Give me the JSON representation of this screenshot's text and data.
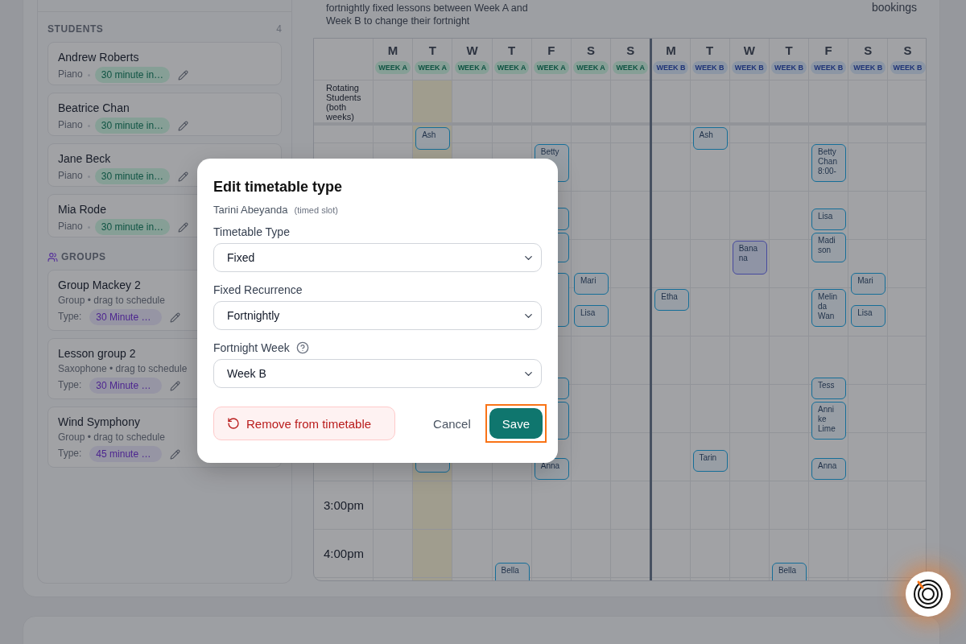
{
  "header": {
    "description": "fortnightly fixed lessons between Week A and Week B to change their fortnight",
    "bookings_label": "bookings"
  },
  "sidebar": {
    "students_title": "STUDENTS",
    "students_count": "4",
    "students": [
      {
        "name": "Andrew Roberts",
        "instrument": "Piano",
        "lesson_type": "30 minute in…"
      },
      {
        "name": "Beatrice Chan",
        "instrument": "Piano",
        "lesson_type": "30 minute in…"
      },
      {
        "name": "Jane Beck",
        "instrument": "Piano",
        "lesson_type": "30 minute in…"
      },
      {
        "name": "Mia Rode",
        "instrument": "Piano",
        "lesson_type": "30 minute in…"
      }
    ],
    "groups_title": "GROUPS",
    "groups": [
      {
        "name": "Group Mackey 2",
        "subtitle": "Group • drag to schedule",
        "type_label": "Type:",
        "lesson_type": "30 Minute …"
      },
      {
        "name": "Lesson group 2",
        "subtitle": "Saxophone • drag to schedule",
        "type_label": "Type:",
        "lesson_type": "30 Minute …"
      },
      {
        "name": "Wind Symphony",
        "subtitle": "Group • drag to schedule",
        "type_label": "Type:",
        "lesson_type": "45 minute …"
      }
    ]
  },
  "timetable": {
    "rotating_label": "Rotating Students (both weeks)",
    "time_labels": [
      {
        "label": "3:00pm"
      },
      {
        "label": "4:00pm"
      }
    ],
    "weeks": [
      {
        "kind": "a",
        "days": [
          {
            "letter": "M",
            "week": "WEEK A",
            "highlighted": false
          },
          {
            "letter": "T",
            "week": "WEEK A",
            "highlighted": true,
            "events": [
              {
                "kind": "student",
                "lines": [
                  "Ash"
                ]
              },
              {
                "kind": "student"
              }
            ]
          },
          {
            "letter": "W",
            "week": "WEEK A",
            "highlighted": false
          },
          {
            "letter": "T",
            "week": "WEEK A",
            "highlighted": false,
            "events": [
              {
                "kind": "student",
                "lines": [
                  "Bella"
                ]
              }
            ]
          },
          {
            "letter": "F",
            "week": "WEEK A",
            "highlighted": false,
            "events": [
              {
                "kind": "student",
                "lines": [
                  "Betty"
                ]
              },
              {
                "kind": "student"
              },
              {
                "kind": "student"
              },
              {
                "kind": "student"
              },
              {
                "kind": "student"
              },
              {
                "kind": "student"
              },
              {
                "kind": "student",
                "lines": [
                  "Anna"
                ]
              }
            ]
          },
          {
            "letter": "S",
            "week": "WEEK A",
            "highlighted": false,
            "events": [
              {
                "kind": "student",
                "lines": [
                  "Mari"
                ]
              },
              {
                "kind": "student",
                "lines": [
                  "Lisa"
                ]
              }
            ]
          },
          {
            "letter": "S",
            "week": "WEEK A",
            "highlighted": false
          }
        ]
      },
      {
        "kind": "b",
        "days": [
          {
            "letter": "M",
            "week": "WEEK B",
            "highlighted": false,
            "events": [
              {
                "kind": "student",
                "lines": [
                  "Etha"
                ]
              }
            ]
          },
          {
            "letter": "T",
            "week": "WEEK B",
            "highlighted": false,
            "events": [
              {
                "kind": "student",
                "lines": [
                  "Ash"
                ]
              },
              {
                "kind": "student",
                "lines": [
                  "Tarin"
                ]
              }
            ]
          },
          {
            "letter": "W",
            "week": "WEEK B",
            "highlighted": false,
            "events": [
              {
                "kind": "group",
                "lines": [
                  "Bana",
                  "na"
                ]
              }
            ]
          },
          {
            "letter": "T",
            "week": "WEEK B",
            "highlighted": false,
            "events": [
              {
                "kind": "student",
                "lines": [
                  "Bella"
                ]
              }
            ]
          },
          {
            "letter": "F",
            "week": "WEEK B",
            "highlighted": false,
            "events": [
              {
                "kind": "student",
                "lines": [
                  "Betty",
                  "Chan",
                  "8:00-"
                ]
              },
              {
                "kind": "student",
                "lines": [
                  "Lisa"
                ]
              },
              {
                "kind": "student",
                "lines": [
                  "Madi",
                  "son"
                ]
              },
              {
                "kind": "student",
                "lines": [
                  "Melin",
                  "da",
                  "Wan"
                ]
              },
              {
                "kind": "student",
                "lines": [
                  "Tess"
                ]
              },
              {
                "kind": "student",
                "lines": [
                  "Anni",
                  "ke",
                  "Lime"
                ]
              },
              {
                "kind": "student",
                "lines": [
                  "Anna"
                ]
              }
            ]
          },
          {
            "letter": "S",
            "week": "WEEK B",
            "highlighted": false,
            "events": [
              {
                "kind": "student",
                "lines": [
                  "Mari"
                ]
              },
              {
                "kind": "student",
                "lines": [
                  "Lisa"
                ]
              }
            ]
          },
          {
            "letter": "S",
            "week": "WEEK B",
            "highlighted": false
          }
        ]
      }
    ]
  },
  "dialog": {
    "title": "Edit timetable type",
    "student": "Tarini Abeyanda",
    "slot_note": "(timed slot)",
    "fields": [
      {
        "label": "Timetable Type",
        "value": "Fixed",
        "help": false
      },
      {
        "label": "Fixed Recurrence",
        "value": "Fortnightly",
        "help": false
      },
      {
        "label": "Fortnight Week",
        "value": "Week B",
        "help": true
      }
    ],
    "remove_button": "Remove from timetable",
    "cancel_button": "Cancel",
    "save_button": "Save",
    "save_focused": true
  }
}
